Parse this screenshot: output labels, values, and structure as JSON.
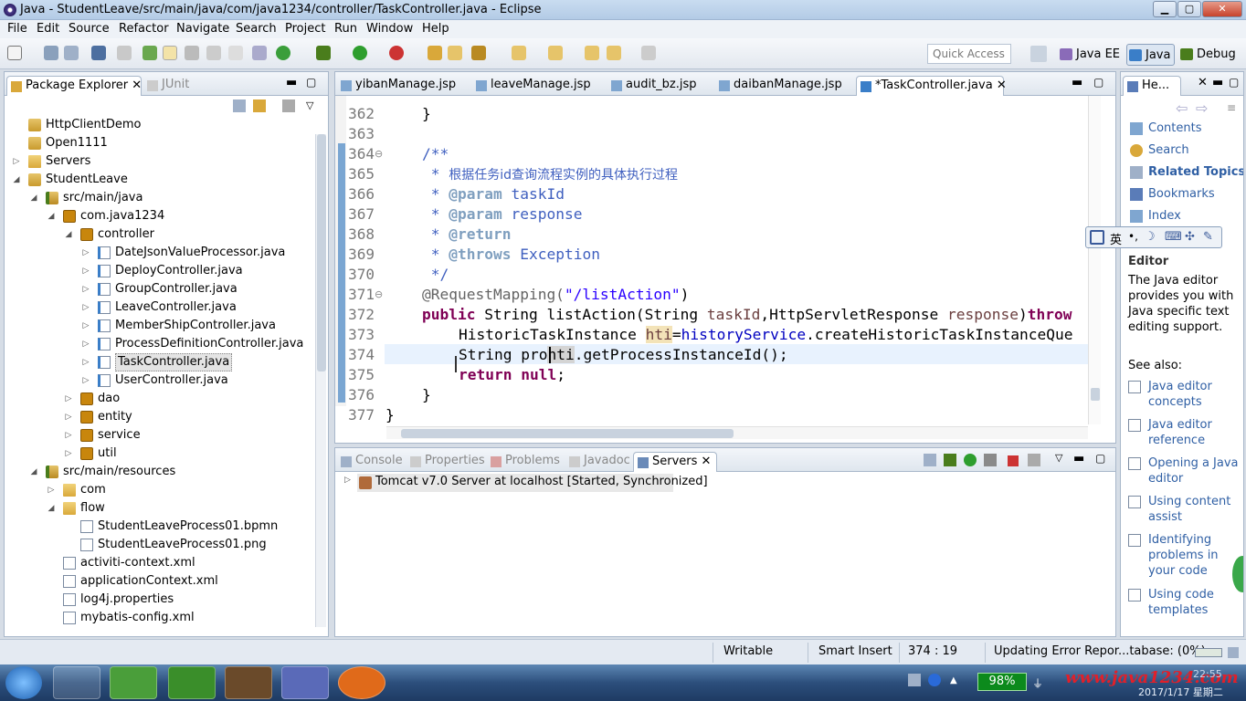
{
  "window": {
    "title": "Java - StudentLeave/src/main/java/com/java1234/controller/TaskController.java - Eclipse",
    "min": "▁",
    "max": "▢",
    "close": "✕"
  },
  "menu": [
    "File",
    "Edit",
    "Source",
    "Refactor",
    "Navigate",
    "Search",
    "Project",
    "Run",
    "Window",
    "Help"
  ],
  "quick_access": {
    "placeholder": "Quick Access"
  },
  "perspectives": [
    "Java EE",
    "Java",
    "Debug"
  ],
  "left_tabs": {
    "package_explorer": "Package Explorer",
    "junit": "JUnit"
  },
  "tree": [
    {
      "label": "HttpClientDemo",
      "depth": 0,
      "arrow": "",
      "icon": "proj"
    },
    {
      "label": "Open1111",
      "depth": 0,
      "arrow": "",
      "icon": "proj"
    },
    {
      "label": "Servers",
      "depth": 0,
      "arrow": "▷",
      "icon": "folder"
    },
    {
      "label": "StudentLeave",
      "depth": 0,
      "arrow": "◢",
      "icon": "proj"
    },
    {
      "label": "src/main/java",
      "depth": 1,
      "arrow": "◢",
      "icon": "src"
    },
    {
      "label": "com.java1234",
      "depth": 2,
      "arrow": "◢",
      "icon": "pkg"
    },
    {
      "label": "controller",
      "depth": 3,
      "arrow": "◢",
      "icon": "pkg"
    },
    {
      "label": "DateJsonValueProcessor.java",
      "depth": 4,
      "arrow": "▷",
      "icon": "java"
    },
    {
      "label": "DeployController.java",
      "depth": 4,
      "arrow": "▷",
      "icon": "java"
    },
    {
      "label": "GroupController.java",
      "depth": 4,
      "arrow": "▷",
      "icon": "java"
    },
    {
      "label": "LeaveController.java",
      "depth": 4,
      "arrow": "▷",
      "icon": "java"
    },
    {
      "label": "MemberShipController.java",
      "depth": 4,
      "arrow": "▷",
      "icon": "java"
    },
    {
      "label": "ProcessDefinitionController.java",
      "depth": 4,
      "arrow": "▷",
      "icon": "java"
    },
    {
      "label": "TaskController.java",
      "depth": 4,
      "arrow": "▷",
      "icon": "java",
      "selected": true
    },
    {
      "label": "UserController.java",
      "depth": 4,
      "arrow": "▷",
      "icon": "java"
    },
    {
      "label": "dao",
      "depth": 3,
      "arrow": "▷",
      "icon": "pkg"
    },
    {
      "label": "entity",
      "depth": 3,
      "arrow": "▷",
      "icon": "pkg"
    },
    {
      "label": "service",
      "depth": 3,
      "arrow": "▷",
      "icon": "pkg"
    },
    {
      "label": "util",
      "depth": 3,
      "arrow": "▷",
      "icon": "pkg"
    },
    {
      "label": "src/main/resources",
      "depth": 1,
      "arrow": "◢",
      "icon": "src"
    },
    {
      "label": "com",
      "depth": 2,
      "arrow": "▷",
      "icon": "folder"
    },
    {
      "label": "flow",
      "depth": 2,
      "arrow": "◢",
      "icon": "folder"
    },
    {
      "label": "StudentLeaveProcess01.bpmn",
      "depth": 3,
      "arrow": "",
      "icon": "file"
    },
    {
      "label": "StudentLeaveProcess01.png",
      "depth": 3,
      "arrow": "",
      "icon": "file"
    },
    {
      "label": "activiti-context.xml",
      "depth": 2,
      "arrow": "",
      "icon": "xml"
    },
    {
      "label": "applicationContext.xml",
      "depth": 2,
      "arrow": "",
      "icon": "xml"
    },
    {
      "label": "log4j.properties",
      "depth": 2,
      "arrow": "",
      "icon": "file"
    },
    {
      "label": "mybatis-config.xml",
      "depth": 2,
      "arrow": "",
      "icon": "xml"
    }
  ],
  "editor_tabs": [
    "yibanManage.jsp",
    "leaveManage.jsp",
    "audit_bz.jsp",
    "daibanManage.jsp",
    "*TaskController.java"
  ],
  "code_lines": [
    {
      "n": "362",
      "fold": ""
    },
    {
      "n": "363",
      "fold": ""
    },
    {
      "n": "364",
      "fold": "⊖"
    },
    {
      "n": "365",
      "fold": ""
    },
    {
      "n": "366",
      "fold": ""
    },
    {
      "n": "367",
      "fold": ""
    },
    {
      "n": "368",
      "fold": ""
    },
    {
      "n": "369",
      "fold": ""
    },
    {
      "n": "370",
      "fold": ""
    },
    {
      "n": "371",
      "fold": "⊖"
    },
    {
      "n": "372",
      "fold": ""
    },
    {
      "n": "373",
      "fold": ""
    },
    {
      "n": "374",
      "fold": ""
    },
    {
      "n": "375",
      "fold": ""
    },
    {
      "n": "376",
      "fold": ""
    },
    {
      "n": "377",
      "fold": ""
    }
  ],
  "code": {
    "l362": "}",
    "l364": "/**",
    "l365a": " * ",
    "l365b": "根据任务id查询流程实例的具体执行过程",
    "l366a": " * ",
    "l366b": "@param",
    "l366c": " taskId",
    "l367a": " * ",
    "l367b": "@param",
    "l367c": " response",
    "l368a": " * ",
    "l368b": "@return",
    "l369a": " * ",
    "l369b": "@throws",
    "l369c": " Exception",
    "l370": " */",
    "l371a": "@RequestMapping(",
    "l371b": "\"/listAction\"",
    "l371c": ")",
    "l372a": "public",
    "l372b": " String listAction(String ",
    "l372c": "taskId",
    "l372d": ",HttpServletResponse ",
    "l372e": "response",
    "l372f": ")",
    "l372g": "throw",
    "l373a": "HistoricTaskInstance ",
    "l373b": "hti",
    "l373c": "=",
    "l373d": "historyService",
    "l373e": ".createHistoricTaskInstanceQue",
    "l374a": "String pro",
    "l374b": "hti",
    "l374c": ".getProcessInstanceId();",
    "l375a": "return",
    "l375b": " ",
    "l375c": "null",
    "l375d": ";",
    "l376": "}",
    "l377": "}"
  },
  "bottom_tabs": [
    "Console",
    "Properties",
    "Problems",
    "Javadoc",
    "Servers"
  ],
  "server_row": "Tomcat v7.0 Server at localhost  [Started, Synchronized]",
  "help": {
    "tab": "He...",
    "links": [
      "Contents",
      "Search",
      "Related Topics",
      "Bookmarks",
      "Index"
    ],
    "section_title": "About the Java Editor",
    "section_title_visible": "Editor",
    "desc": "The Java editor provides you with Java specific text editing support.",
    "see_also": "See also:",
    "items": [
      "Java editor concepts",
      "Java editor reference",
      "Opening a Java editor",
      "Using content assist",
      "Identifying problems in your code",
      "Using code templates"
    ]
  },
  "ime": {
    "lang": "英"
  },
  "status": {
    "writable": "Writable",
    "insert": "Smart Insert",
    "position": "374 : 19",
    "progress": "Updating Error Repor...tabase: (0%)"
  },
  "taskbar": {
    "battery": "98%",
    "time": "22:55",
    "date": "2017/1/17 星期二",
    "watermark": "www.java1234.com"
  },
  "colors": {
    "keyword": "#7f0055",
    "comment": "#3f5fbf",
    "string": "#2a00ff",
    "field": "#0000c0",
    "link": "#2f5fa4"
  }
}
